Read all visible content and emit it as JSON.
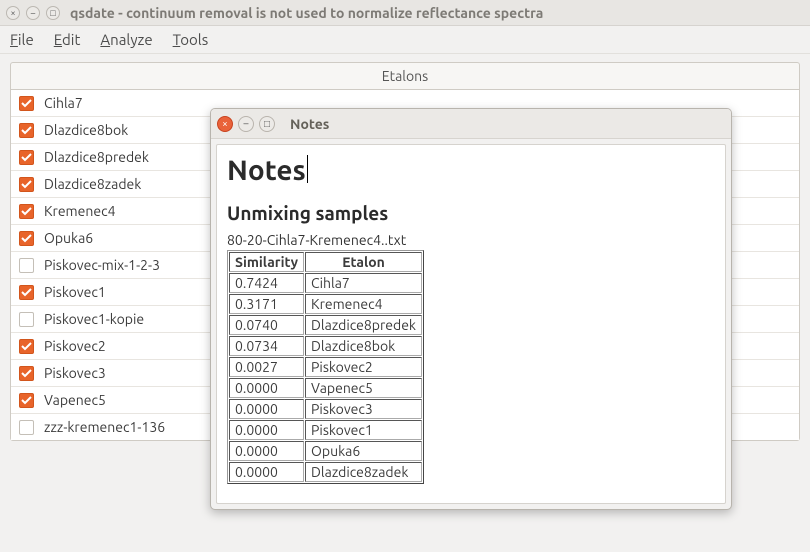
{
  "window": {
    "title": "qsdate - continuum removal is not used to normalize reflectance spectra"
  },
  "menubar": {
    "items": [
      {
        "label": "File",
        "accel": "F"
      },
      {
        "label": "Edit",
        "accel": "E"
      },
      {
        "label": "Analyze",
        "accel": "A"
      },
      {
        "label": "Tools",
        "accel": "T"
      }
    ]
  },
  "etalons": {
    "header": "Etalons",
    "rows": [
      {
        "label": "Cihla7",
        "checked": true
      },
      {
        "label": "Dlazdice8bok",
        "checked": true
      },
      {
        "label": "Dlazdice8predek",
        "checked": true
      },
      {
        "label": "Dlazdice8zadek",
        "checked": true
      },
      {
        "label": "Kremenec4",
        "checked": true
      },
      {
        "label": "Opuka6",
        "checked": true
      },
      {
        "label": "Piskovec-mix-1-2-3",
        "checked": false
      },
      {
        "label": "Piskovec1",
        "checked": true
      },
      {
        "label": "Piskovec1-kopie",
        "checked": false
      },
      {
        "label": "Piskovec2",
        "checked": true
      },
      {
        "label": "Piskovec3",
        "checked": true
      },
      {
        "label": "Vapenec5",
        "checked": true
      },
      {
        "label": "zzz-kremenec1-136",
        "checked": false
      }
    ]
  },
  "dialog": {
    "title": "Notes",
    "heading1": "Notes",
    "heading2": "Unmixing samples",
    "caption": "80-20-Cihla7-Kremenec4..txt",
    "columns": {
      "c1": "Similarity",
      "c2": "Etalon"
    },
    "rows": [
      {
        "sim": "0.7424",
        "et": "Cihla7"
      },
      {
        "sim": "0.3171",
        "et": "Kremenec4"
      },
      {
        "sim": "0.0740",
        "et": "Dlazdice8predek"
      },
      {
        "sim": "0.0734",
        "et": "Dlazdice8bok"
      },
      {
        "sim": "0.0027",
        "et": "Piskovec2"
      },
      {
        "sim": "0.0000",
        "et": "Vapenec5"
      },
      {
        "sim": "0.0000",
        "et": "Piskovec3"
      },
      {
        "sim": "0.0000",
        "et": "Piskovec1"
      },
      {
        "sim": "0.0000",
        "et": "Opuka6"
      },
      {
        "sim": "0.0000",
        "et": "Dlazdice8zadek"
      }
    ]
  }
}
